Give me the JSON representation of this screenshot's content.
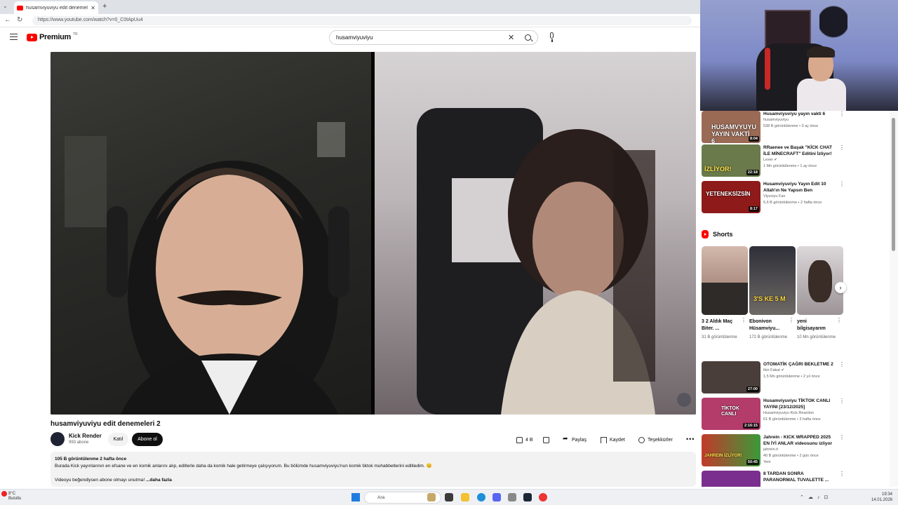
{
  "browser": {
    "tab_title": "husamviyuviyu edit denemeleri",
    "url": "https://www.youtube.com/watch?v=0_C0tApUu4"
  },
  "header": {
    "logo_text": "Premium",
    "country": "TR",
    "search_query": "husamviyuviyu"
  },
  "video": {
    "title": "husamviyuviyu edit denemeleri 2",
    "channel": "Kick Render",
    "subscribers": "993 abone",
    "join_label": "Katıl",
    "subscribe_label": "Abone ol",
    "likes": "4 B",
    "share_label": "Paylaş",
    "save_label": "Kaydet",
    "thanks_label": "Teşekkürler",
    "description": {
      "meta": "105 B görüntülenme  2 hafta önce",
      "line1": "Burada Kick yayınlarının en efsane ve en komik anlarını alıp, editlerle daha da komik hale getirmeye çalışıyorum. Bu bölümde husamviyuviyu'nun komik tiktok muhabbetlerini editledim. 😊",
      "line2": "Videoyu beğendiysen abone olmayı unutma!",
      "more": "...daha fazla"
    }
  },
  "sidebar": {
    "top_videos": [
      {
        "title": "Husamviyuviyu yayın vakti 6",
        "channel": "husamviyuviyu",
        "meta": "538 B görüntülenme • 3 ay önce",
        "duration": "8:04",
        "thumb_text": "HUSAMVYUYU YAYIN VAKTİ 6",
        "thumb_color": "#9b6a55"
      },
      {
        "title": "RRaenee ve Başak \"KİCK CHAT İLE MİNECRAFT\" Editini İzliyor!",
        "channel": "Lexer ✔",
        "meta": "1 Mn görüntülenme • 1 ay önce",
        "duration": "22:18",
        "thumb_text": "İZLİYOR!",
        "thumb_color": "#6a7a4a"
      },
      {
        "title": "Husamviyuviyu Yayın Edit 10 Allah'ın Ne Yapsın Ben",
        "channel": "Viyuviyu Fan",
        "meta": "5,6 B görüntülenme • 2 hafta önce",
        "duration": "8:17",
        "thumb_text": "YETENEKSİZSİN",
        "thumb_color": "#8e1a1a"
      }
    ],
    "shorts_title": "Shorts",
    "shorts": [
      {
        "title": "3 2 Aldık Maç Biter. ...",
        "views": "31 B görüntülenme",
        "thumb_color": "#b59a8c",
        "thumb_text": ""
      },
      {
        "title": "Ebonivon Hüsamviyu...",
        "views": "172 B görüntülenme",
        "thumb_color": "#3a3a44",
        "thumb_text": "3'S KE 5 M"
      },
      {
        "title": "yeni bilgisayarım",
        "views": "10 Mn görüntülenme",
        "thumb_color": "#c9c4c6",
        "thumb_text": ""
      }
    ],
    "bottom_videos": [
      {
        "title": "OTOMATİK ÇAĞRI BEKLETME 2",
        "channel": "Ikin Fakat ✔",
        "meta": "1,5 Mn görüntülenme • 2 yıl önce",
        "duration": "27:00",
        "thumb_text": "",
        "thumb_color": "#4a3e3a"
      },
      {
        "title": "Husamviyuviyu TİKTOK CANLI YAYINI [23/12/2025]",
        "channel": "Husamviyuviyu Kick Reaction",
        "meta": "61 B görüntülenme • 3 hafta önce",
        "duration": "2:16:15",
        "thumb_text": "TİKTOK CANLI",
        "thumb_color": "#b43c6a"
      },
      {
        "title": "Jahrein - KICK WRAPPED 2025 EN İYİ ANLAR videosunu izliyor",
        "channel": "jahrein.tr",
        "meta": "40 B görüntülenme • 2 gün önce",
        "duration": "50:45",
        "thumb_text": "JAHREIN İZLİYOR!",
        "thumb_color": "#c23a2a",
        "badge": "Yeni"
      },
      {
        "title": "8 TARDAN SONRA PARANORMAL TUVALETTE ...",
        "channel": "",
        "meta": "",
        "duration": "",
        "thumb_text": "",
        "thumb_color": "#7a2f8e"
      }
    ]
  },
  "taskbar": {
    "weather_temp": "8°C",
    "weather_desc": "Bulutlu",
    "search_placeholder": "Ara",
    "time": "19:34",
    "date": "14.01.2026"
  },
  "colors": {
    "brand_red": "#ff0000",
    "text_primary": "#0f0f0f",
    "text_secondary": "#606060"
  }
}
